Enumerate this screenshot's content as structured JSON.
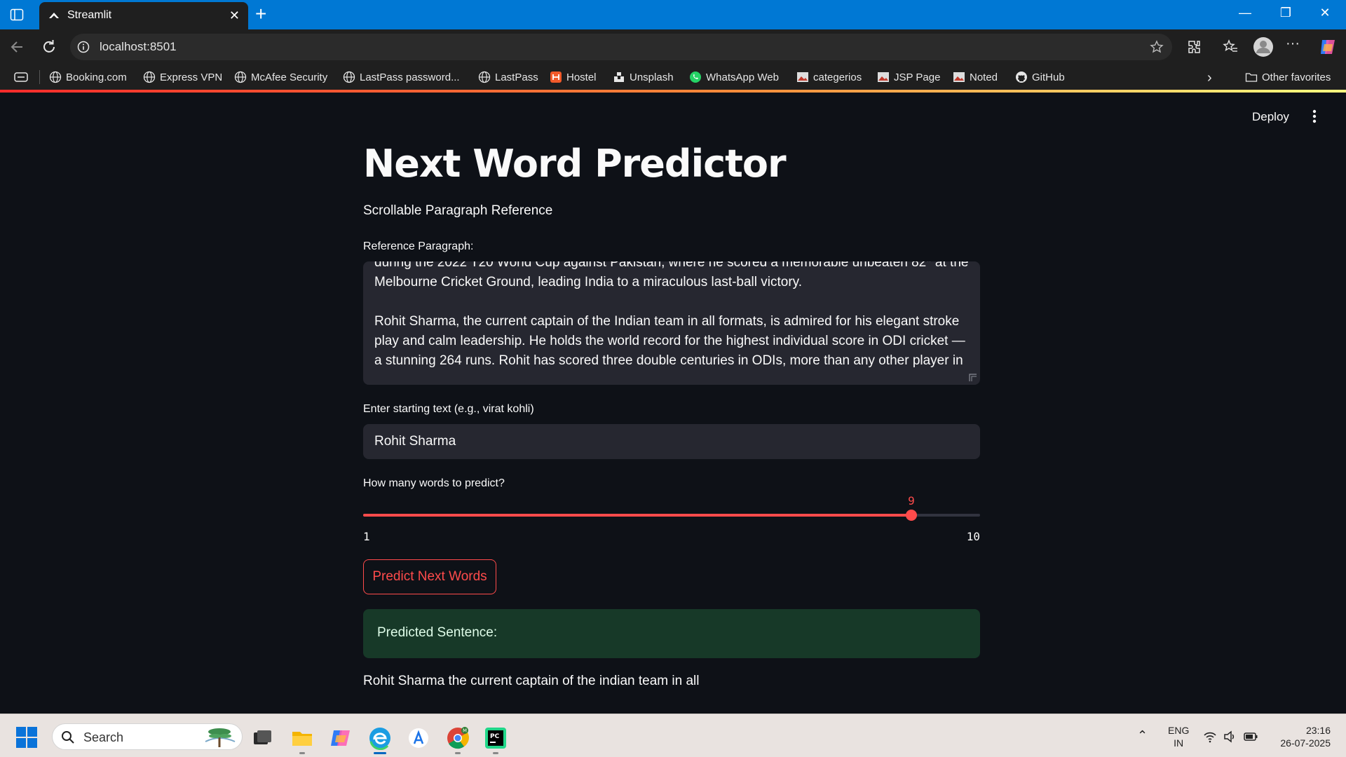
{
  "browser": {
    "tab_title": "Streamlit",
    "address": "localhost:8501",
    "bookmarks": [
      "Booking.com",
      "Express VPN",
      "McAfee Security",
      "LastPass password...",
      "LastPass",
      "Hostel",
      "Unsplash",
      "WhatsApp Web",
      "categerios",
      "JSP Page",
      "Noted",
      "GitHub"
    ],
    "other_favorites": "Other favorites"
  },
  "app": {
    "deploy_label": "Deploy",
    "title": "Next Word Predictor",
    "subtitle": "Scrollable Paragraph Reference",
    "reference_label": "Reference Paragraph:",
    "reference_text": "during the 2022 T20 World Cup against Pakistan, where he scored a memorable unbeaten 82* at the Melbourne Cricket Ground, leading India to a miraculous last-ball victory.\n\nRohit Sharma, the current captain of the Indian team in all formats, is admired for his elegant stroke play and calm leadership. He holds the world record for the highest individual score in ODI cricket — a stunning 264 runs. Rohit has scored three double centuries in ODIs, more than any other player in",
    "input_label": "Enter starting text (e.g., virat kohli)",
    "input_value": "Rohit Sharma",
    "slider_label": "How many words to predict?",
    "slider_value": "9",
    "slider_min": "1",
    "slider_max": "10",
    "slider_fraction": 0.889,
    "button_label": "Predict Next Words",
    "alert_text": "Predicted Sentence:",
    "result_text": "Rohit Sharma the current captain of the indian team in all",
    "accent_color": "#ff4b4b"
  },
  "taskbar": {
    "search_placeholder": "Search",
    "lang_line1": "ENG",
    "lang_line2": "IN",
    "time": "23:16",
    "date": "26-07-2025"
  }
}
